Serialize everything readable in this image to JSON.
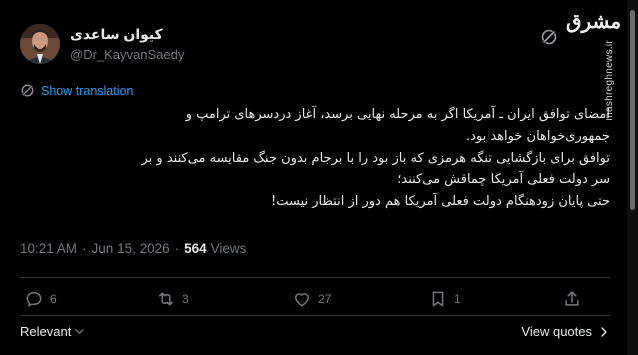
{
  "author": {
    "display_name": "کیوان ساعدی",
    "handle": "@Dr_KayvanSaedy"
  },
  "branding": {
    "site_logo_text": "مشرق",
    "watermark_url": "mashreghnews.ir"
  },
  "translate": {
    "label": "Show translation"
  },
  "tweet": {
    "lines": [
      "امضای توافق ایران ـ آمریکا اگر به مرحله نهایی برسد، آغاز دردسرهای ترامپ و",
      "جمهوری‌خواهان خواهد بود.",
      "توافق برای بازگشایی تنگه هرمزی که باز بود را با برجام بدون جنگ مقایسه می‌کنند و بر",
      "سر دولت فعلی آمریکا چماقش می‌کنند؛",
      "حتی پایان زودهنگام دولت فعلی آمریکا هم دور از انتظار نیست!"
    ]
  },
  "meta": {
    "time": "10:21 AM",
    "separator": "·",
    "date": "Jun 15, 2026",
    "views_count": "564",
    "views_label": "Views"
  },
  "actions": {
    "reply_count": "6",
    "repost_count": "3",
    "like_count": "27",
    "bookmark_count": "1"
  },
  "footer": {
    "sort_label": "Relevant",
    "view_quotes_label": "View quotes"
  },
  "colors": {
    "background": "#000000",
    "text": "#e7e9ea",
    "muted": "#71767b",
    "link": "#1d9bf0",
    "divider": "#2f3336"
  },
  "icons": {
    "grok": "grok-icon",
    "translate": "grok-translate-icon",
    "reply": "reply-icon",
    "repost": "repost-icon",
    "like": "heart-icon",
    "bookmark": "bookmark-icon",
    "share": "share-icon",
    "sort": "chevron-down-icon",
    "quotes": "chevron-right-icon"
  }
}
